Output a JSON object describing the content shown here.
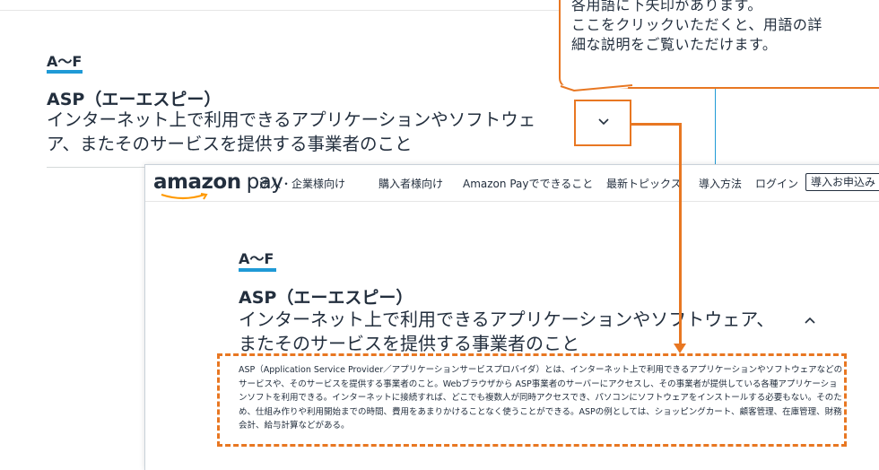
{
  "background_page": {
    "section_heading": "A〜F",
    "term": "ASP（エーエスピー）",
    "short_description": "インターネット上で利用できるアプリケーションやソフトウェア、またそのサービスを提供する事業者のこと",
    "toggle_icon": "chevron-down-icon"
  },
  "callout": {
    "lines": [
      "各用語に下矢印があります。",
      "ここをクリックいただくと、用語の詳",
      "細な説明をご覧いただけます。"
    ]
  },
  "front_page": {
    "logo": {
      "brand": "amazon",
      "product": "pay"
    },
    "nav": {
      "items": [
        "法人・企業様向け",
        "購入者様向け",
        "Amazon Payでできること",
        "最新トピックス",
        "導入方法",
        "ログイン"
      ],
      "cta": "導入お申込み"
    },
    "section_heading": "A〜F",
    "term": "ASP（エーエスピー）",
    "short_description": "インターネット上で利用できるアプリケーションやソフトウェア、またそのサービスを提供する事業者のこと",
    "toggle_icon": "chevron-up-icon",
    "detail": "ASP（Application Service Provider／アプリケーションサービスプロバイダ）とは、インターネット上で利用できるアプリケーションやソフトウェアなどのサービスや、そのサービスを提供する事業者のこと。Webブラウザから ASP事業者のサーバーにアクセスし、その事業者が提供している各種アプリケーションソフトを利用できる。インターネットに接続すれば、どこでも複数人が同時アクセスでき、パソコンにソフトウェアをインストールする必要もない。そのため、仕組み作りや利用開始までの時間、費用をあまりかけることなく使うことができる。ASPの例としては、ショッピングカート、顧客管理、在庫管理、財務会計、給与計算などがある。"
  },
  "colors": {
    "accent_orange": "#e87722",
    "underline_blue": "#1f9ad6",
    "text_dark": "#232f3e"
  }
}
